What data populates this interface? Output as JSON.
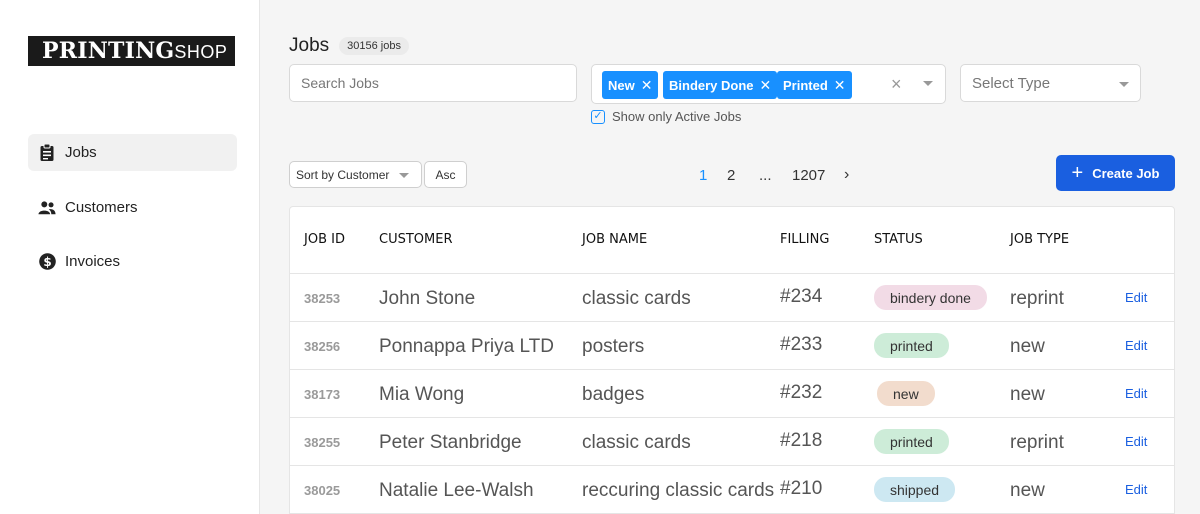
{
  "logo": {
    "bold": "PRINTING",
    "light": "SHOP"
  },
  "nav": [
    {
      "label": "Jobs",
      "icon": "clipboard-icon",
      "active": true
    },
    {
      "label": "Customers",
      "icon": "users-icon",
      "active": false
    },
    {
      "label": "Invoices",
      "icon": "dollar-icon",
      "active": false
    }
  ],
  "header": {
    "title": "Jobs",
    "count": "30156 jobs"
  },
  "filters": {
    "search_placeholder": "Search Jobs",
    "status_tags": [
      "New",
      "Bindery Done",
      "Printed"
    ],
    "type_placeholder": "Select Type",
    "active_only_label": "Show only Active Jobs",
    "active_only_checked": true
  },
  "sort": {
    "field": "Sort by Customer",
    "order": "Asc"
  },
  "pagination": {
    "pages": [
      "1",
      "2",
      "...",
      "1207"
    ],
    "current": "1",
    "next": "›"
  },
  "actions": {
    "create_job": "Create Job"
  },
  "table": {
    "columns": [
      "JOB ID",
      "CUSTOMER",
      "JOB NAME",
      "FILLING",
      "STATUS",
      "JOB TYPE"
    ],
    "edit_label": "Edit",
    "rows": [
      {
        "id": "38253",
        "customer": "John Stone",
        "job_name": "classic cards",
        "filling": "#234",
        "status": "bindery done",
        "job_type": "reprint"
      },
      {
        "id": "38256",
        "customer": "Ponnappa Priya LTD",
        "job_name": "posters",
        "filling": "#233",
        "status": "printed",
        "job_type": "new"
      },
      {
        "id": "38173",
        "customer": "Mia Wong",
        "job_name": "badges",
        "filling": "#232",
        "status": "new",
        "job_type": "new"
      },
      {
        "id": "38255",
        "customer": "Peter Stanbridge",
        "job_name": "classic cards",
        "filling": "#218",
        "status": "printed",
        "job_type": "reprint"
      },
      {
        "id": "38025",
        "customer": "Natalie Lee-Walsh",
        "job_name": "reccuring classic cards",
        "filling": "#210",
        "status": "shipped",
        "job_type": "new"
      }
    ]
  },
  "status_colors": {
    "bindery done": "#f2dbe6",
    "printed": "#cdecd8",
    "new": "#f2dccd",
    "shipped": "#cde8f2"
  },
  "accent_color": "#1a5fe0"
}
